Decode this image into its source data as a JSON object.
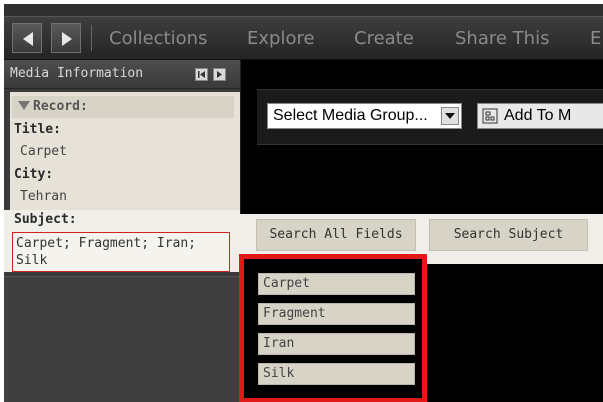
{
  "nav": {
    "items": [
      "Collections",
      "Explore",
      "Create",
      "Share This",
      "E"
    ]
  },
  "panel": {
    "title": "Media Information",
    "record_label": "Record:",
    "fields": [
      {
        "label": "Title:",
        "value": "Carpet"
      },
      {
        "label": "City:",
        "value": "Tehran"
      }
    ],
    "subject_label": "Subject:",
    "subject_value": "Carpet; Fragment; Iran; Silk"
  },
  "toolbar": {
    "select_value": "Select Media Group...",
    "add_label": "Add To M"
  },
  "search": {
    "all_fields": "Search All Fields",
    "subject": "Search Subject"
  },
  "results": [
    "Carpet",
    "Fragment",
    "Iran",
    "Silk"
  ],
  "colors": {
    "highlight_red": "#e01818",
    "panel_beige": "#e6e2d8"
  }
}
